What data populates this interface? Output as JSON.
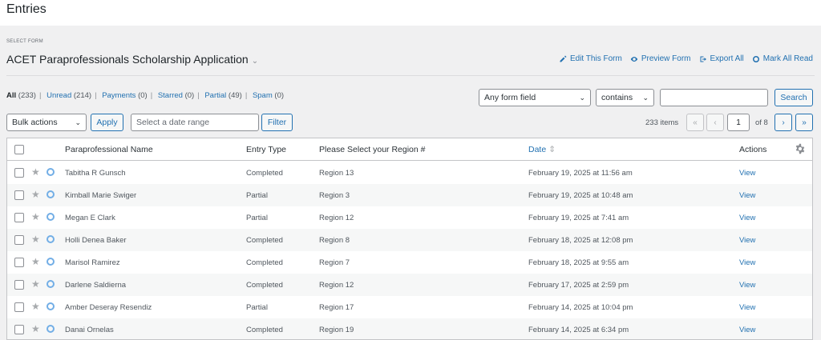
{
  "page": {
    "title": "Entries"
  },
  "form": {
    "label": "SELECT FORM",
    "name": "ACET Paraprofessionals Scholarship Application"
  },
  "actions": {
    "edit": "Edit This Form",
    "preview": "Preview Form",
    "export": "Export All",
    "mark_read": "Mark All Read"
  },
  "filters": [
    {
      "label": "All",
      "count": "(233)"
    },
    {
      "label": "Unread",
      "count": "(214)"
    },
    {
      "label": "Payments",
      "count": "(0)"
    },
    {
      "label": "Starred",
      "count": "(0)"
    },
    {
      "label": "Partial",
      "count": "(49)"
    },
    {
      "label": "Spam",
      "count": "(0)"
    }
  ],
  "search": {
    "field": "Any form field",
    "operator": "contains",
    "value": "",
    "button": "Search"
  },
  "bulk": {
    "select": "Bulk actions",
    "apply": "Apply",
    "date_placeholder": "Select a date range",
    "filter": "Filter"
  },
  "pagination": {
    "items": "233 items",
    "first": "«",
    "prev": "‹",
    "current": "1",
    "of": "of 8",
    "next": "›",
    "last": "»"
  },
  "table": {
    "columns": {
      "name": "Paraprofessional Name",
      "type": "Entry Type",
      "region": "Please Select your Region #",
      "date": "Date",
      "actions": "Actions"
    },
    "rows": [
      {
        "name": "Tabitha R Gunsch",
        "type": "Completed",
        "region": "Region 13",
        "date": "February 19, 2025 at 11:56 am",
        "action": "View"
      },
      {
        "name": "Kimball Marie Swiger",
        "type": "Partial",
        "region": "Region 3",
        "date": "February 19, 2025 at 10:48 am",
        "action": "View"
      },
      {
        "name": "Megan E Clark",
        "type": "Partial",
        "region": "Region 12",
        "date": "February 19, 2025 at 7:41 am",
        "action": "View"
      },
      {
        "name": "Holli Denea Baker",
        "type": "Completed",
        "region": "Region 8",
        "date": "February 18, 2025 at 12:08 pm",
        "action": "View"
      },
      {
        "name": "Marisol Ramirez",
        "type": "Completed",
        "region": "Region 7",
        "date": "February 18, 2025 at 9:55 am",
        "action": "View"
      },
      {
        "name": "Darlene Saldierna",
        "type": "Completed",
        "region": "Region 12",
        "date": "February 17, 2025 at 2:59 pm",
        "action": "View"
      },
      {
        "name": "Amber Deseray Resendiz",
        "type": "Partial",
        "region": "Region 17",
        "date": "February 14, 2025 at 10:04 pm",
        "action": "View"
      },
      {
        "name": "Danai Ornelas",
        "type": "Completed",
        "region": "Region 19",
        "date": "February 14, 2025 at 6:34 pm",
        "action": "View"
      }
    ]
  },
  "colors": {
    "accent": "#2271b1",
    "unread": "#72aee6"
  }
}
